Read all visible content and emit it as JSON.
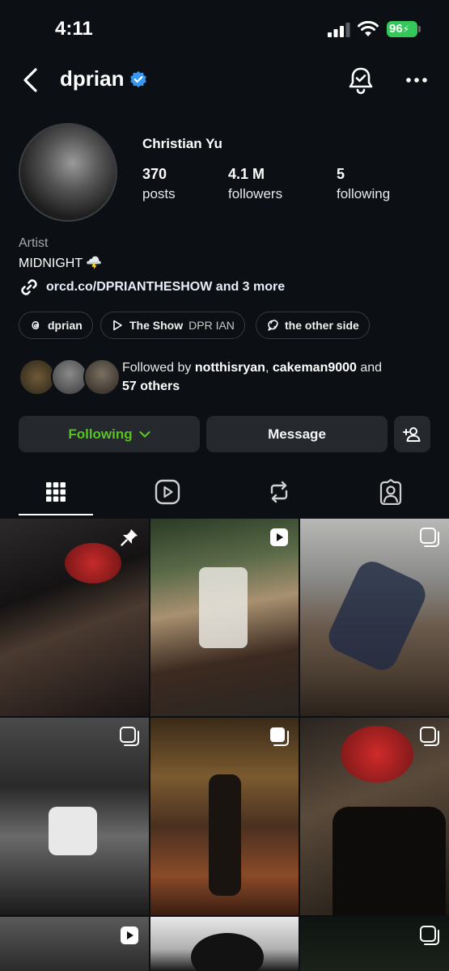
{
  "status_bar": {
    "time": "4:11",
    "battery": "96"
  },
  "header": {
    "username": "dprian"
  },
  "profile": {
    "full_name": "Christian Yu",
    "stats": [
      {
        "value": "370",
        "label": "posts"
      },
      {
        "value": "4.1 M",
        "label": "followers"
      },
      {
        "value": "5",
        "label": "following"
      }
    ],
    "category": "Artist",
    "bio": "MIDNIGHT 🌩️",
    "link": "orcd.co/DPRIANTHESHOW and 3 more"
  },
  "chips": [
    {
      "label": "dprian",
      "sub": ""
    },
    {
      "label": "The Show",
      "sub": "DPR IAN"
    },
    {
      "label": "the other side",
      "sub": ""
    }
  ],
  "followed_by": {
    "prefix": "Followed by ",
    "user1": "notthisryan",
    "sep": ", ",
    "user2": "cakeman9000",
    "and": " and",
    "others": "57 others"
  },
  "buttons": {
    "following": "Following",
    "message": "Message"
  },
  "tabs": [
    "posts-grid",
    "reels",
    "reposts",
    "tagged"
  ],
  "colors": {
    "background": "#0c1014",
    "following_green": "#58c322",
    "verified_blue": "#3897f0",
    "battery_green": "#34c759"
  }
}
